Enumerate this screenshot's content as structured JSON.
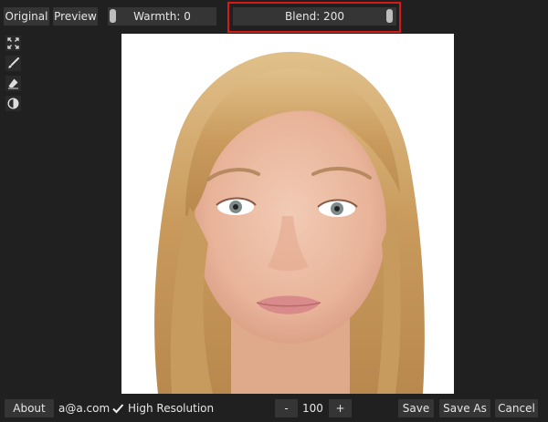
{
  "toolbar": {
    "original_label": "Original",
    "preview_label": "Preview",
    "warmth_label": "Warmth: 0",
    "blend_label": "Blend: 200"
  },
  "tools": [
    "fit-screen-icon",
    "brush-icon",
    "eraser-icon",
    "contrast-icon"
  ],
  "bottom": {
    "about_label": "About",
    "email": "a@a.com",
    "high_res_label": "High Resolution",
    "high_res_checked": true,
    "minus_label": "-",
    "zoom_value": "100",
    "plus_label": "+",
    "save_label": "Save",
    "save_as_label": "Save As",
    "cancel_label": "Cancel"
  },
  "colors": {
    "background": "#202020",
    "button": "#353535",
    "highlight": "#d61a1a"
  }
}
